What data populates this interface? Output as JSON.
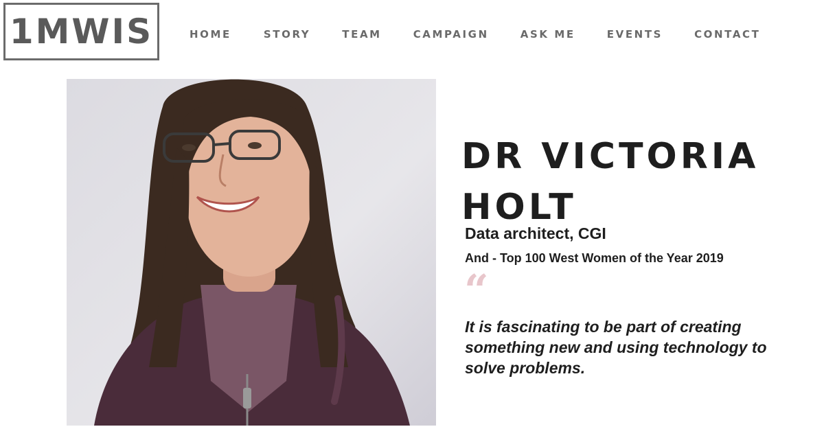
{
  "logo": {
    "text": "1MWIS"
  },
  "nav": {
    "items": [
      {
        "label": "HOME"
      },
      {
        "label": "STORY"
      },
      {
        "label": "TEAM"
      },
      {
        "label": "CAMPAIGN"
      },
      {
        "label": "ASK ME"
      },
      {
        "label": "EVENTS"
      },
      {
        "label": "CONTACT"
      }
    ]
  },
  "profile": {
    "name": "DR VICTORIA HOLT",
    "role": "Data architect, CGI",
    "award": "And - Top 100 West Women of the Year 2019",
    "quote_mark": "“",
    "quote": "It is fascinating to be part of creating something new and using technology to solve problems."
  },
  "colors": {
    "logo_gray": "#5a5a5a",
    "nav_gray": "#6a6a6a",
    "text_dark": "#1e1e1e",
    "quote_pink": "#e8c6cb"
  }
}
